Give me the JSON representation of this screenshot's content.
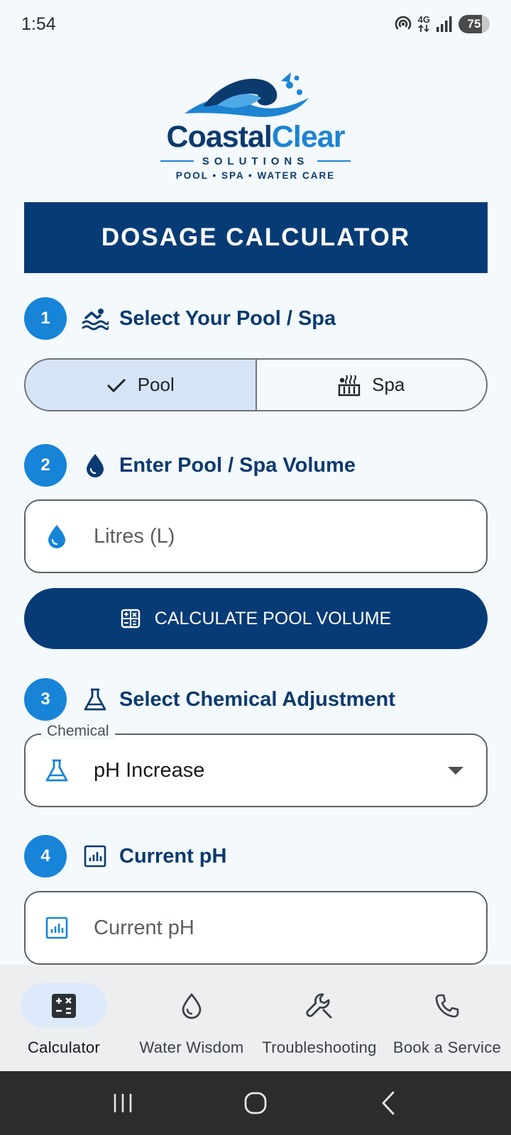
{
  "status_bar": {
    "time": "1:54",
    "network": "4G",
    "battery": "75",
    "battery_level": 0.75
  },
  "brand": {
    "name_part1": "Coastal",
    "name_part2": "Clear",
    "subtitle": "SOLUTIONS",
    "tagline": "POOL • SPA • WATER CARE"
  },
  "header": {
    "title": "DOSAGE CALCULATOR"
  },
  "sections": [
    {
      "number": "1",
      "title": "Select Your Pool / Spa",
      "icon": "swimmer-icon"
    },
    {
      "number": "2",
      "title": "Enter Pool / Spa Volume",
      "icon": "water-drop-icon"
    },
    {
      "number": "3",
      "title": "Select Chemical Adjustment",
      "icon": "flask-icon"
    },
    {
      "number": "4",
      "title": "Current pH",
      "icon": "chart-icon"
    }
  ],
  "pool_type": {
    "options": [
      "Pool",
      "Spa"
    ],
    "selected": "Pool"
  },
  "volume": {
    "placeholder": "Litres (L)"
  },
  "calculate_button": {
    "label": "CALCULATE POOL VOLUME"
  },
  "chemical": {
    "legend": "Chemical",
    "value": "pH Increase"
  },
  "current_ph": {
    "placeholder": "Current pH"
  },
  "nav": {
    "items": [
      {
        "label": "Calculator",
        "icon": "calculator-icon",
        "active": true
      },
      {
        "label": "Water Wisdom",
        "icon": "water-drop-outline-icon",
        "active": false
      },
      {
        "label": "Troubleshooting",
        "icon": "wrench-icon",
        "active": false
      },
      {
        "label": "Book a Service",
        "icon": "phone-icon",
        "active": false
      }
    ]
  },
  "colors": {
    "primary": "#073b75",
    "accent": "#1784d8",
    "selected_segment": "#d5e4f7",
    "background": "#f3f9fd"
  }
}
